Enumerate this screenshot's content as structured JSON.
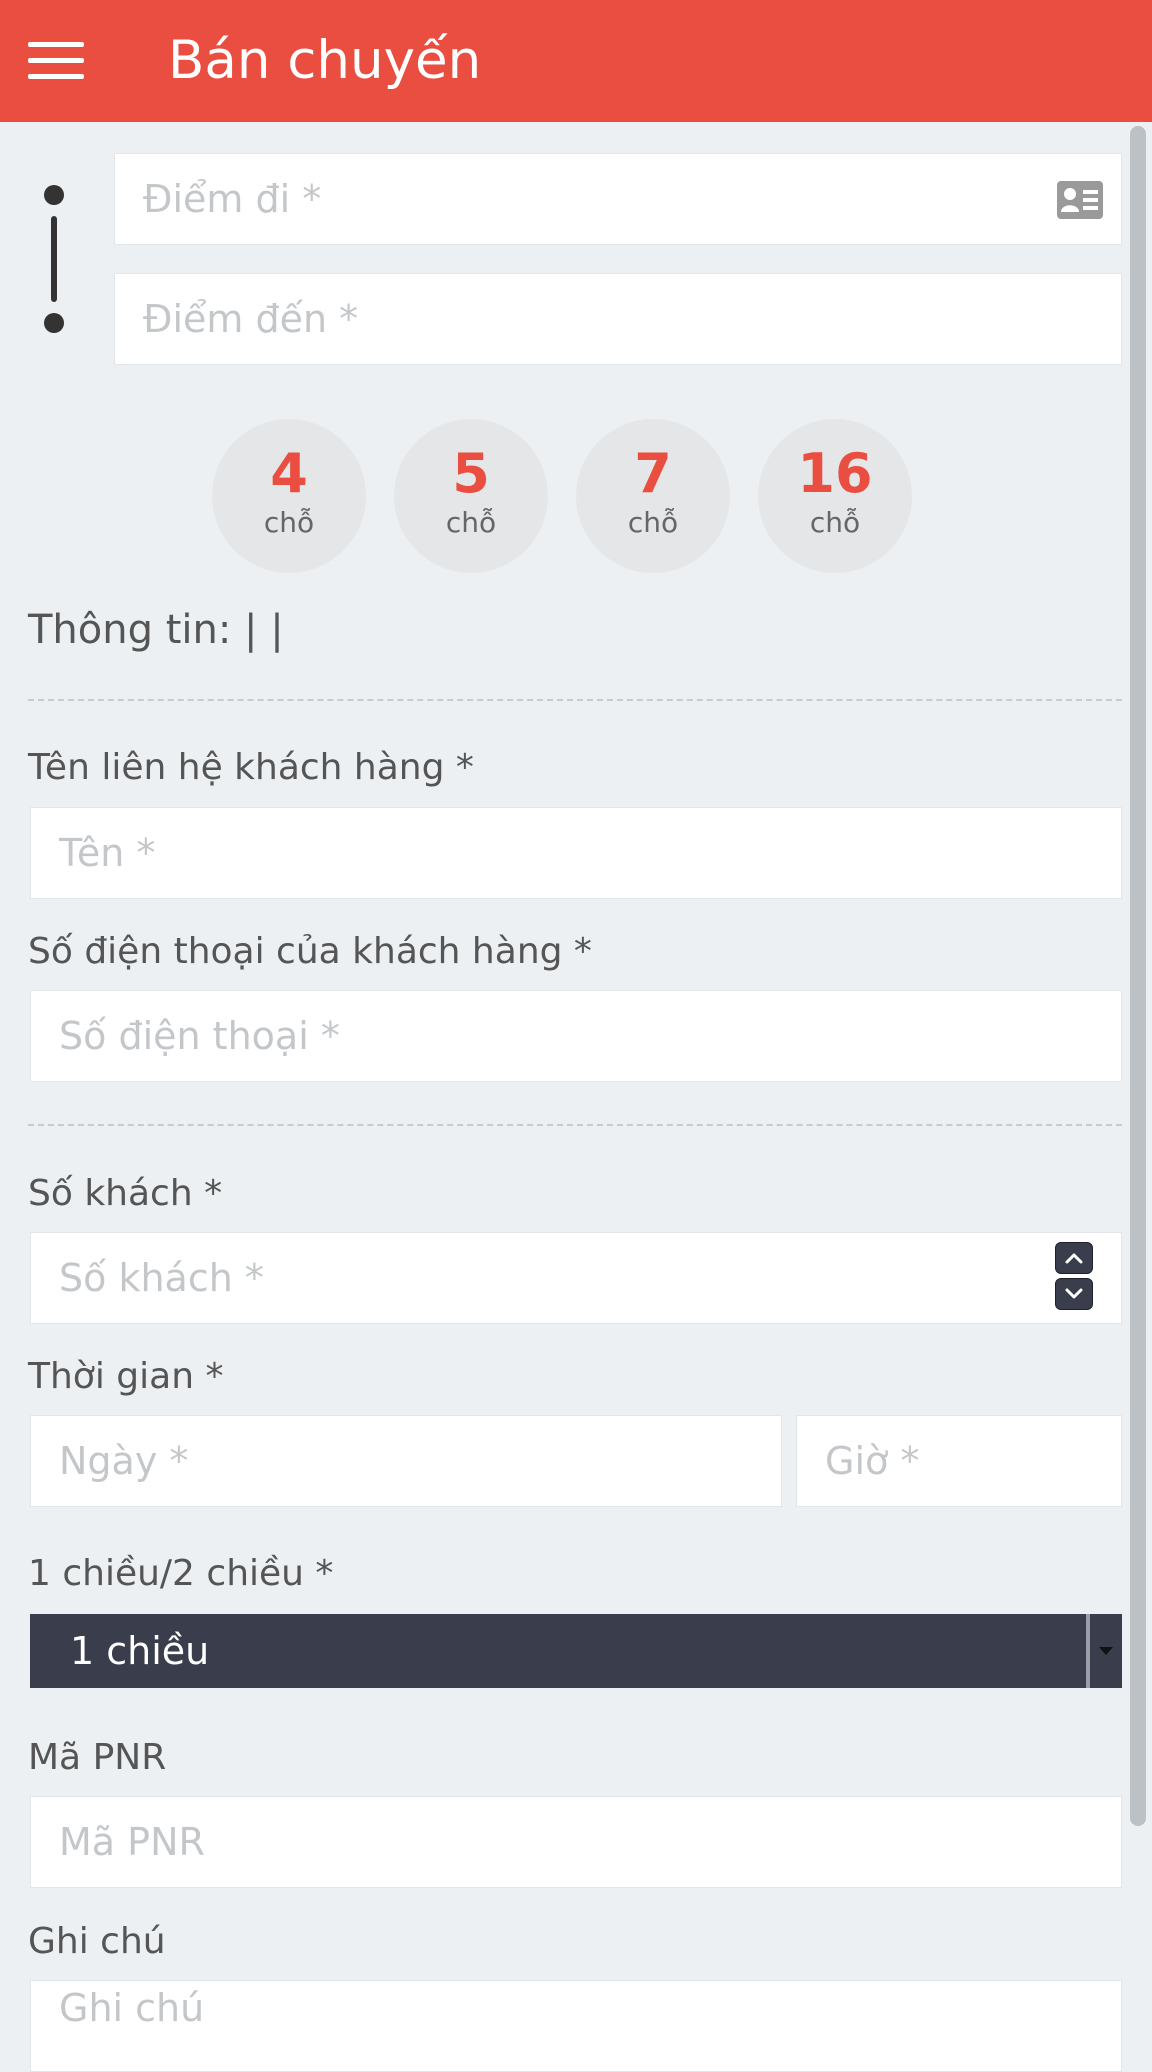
{
  "header": {
    "title": "Bán chuyến",
    "menu_icon": "hamburger-menu-icon"
  },
  "route": {
    "origin_placeholder": "Điểm đi *",
    "destination_placeholder": "Điểm đến *",
    "route_icon": "route-line-icon",
    "contact_icon": "contact-card-icon"
  },
  "seats": [
    {
      "number": "4",
      "unit": "chỗ"
    },
    {
      "number": "5",
      "unit": "chỗ"
    },
    {
      "number": "7",
      "unit": "chỗ"
    },
    {
      "number": "16",
      "unit": "chỗ"
    }
  ],
  "info_text": "Thông tin: | |",
  "customer": {
    "name_label": "Tên liên hệ khách hàng *",
    "name_placeholder": "Tên *",
    "phone_label": "Số điện thoại của khách hàng *",
    "phone_placeholder": "Số điện thoại *"
  },
  "passengers": {
    "label": "Số khách *",
    "placeholder": "Số khách *"
  },
  "time": {
    "label": "Thời gian *",
    "date_placeholder": "Ngày *",
    "hour_placeholder": "Giờ *"
  },
  "trip_type": {
    "label": "1 chiều/2 chiều *",
    "selected": "1 chiều"
  },
  "pnr": {
    "label": "Mã PNR",
    "placeholder": "Mã PNR"
  },
  "note": {
    "label": "Ghi chú",
    "placeholder": "Ghi chú"
  },
  "colors": {
    "accent": "#e94e40",
    "background": "#ecf0f3",
    "select_background": "#3a3d4b"
  }
}
